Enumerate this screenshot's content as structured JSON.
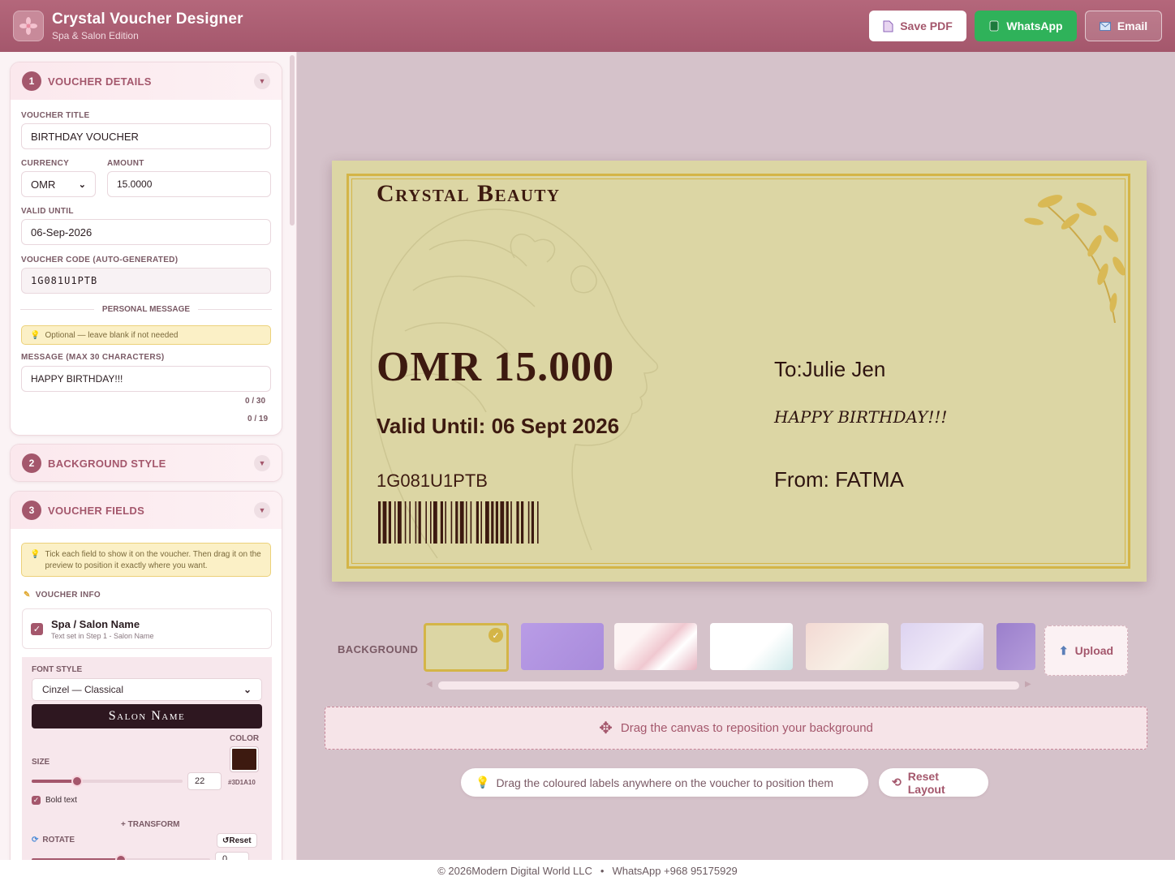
{
  "header": {
    "title": "Crystal Voucher Designer",
    "subtitle": "Spa & Salon Edition",
    "save_pdf": "Save PDF",
    "whatsapp": "WhatsApp",
    "email": "Email"
  },
  "sidebar": {
    "step1": {
      "num": "1",
      "title": "VOUCHER DETAILS"
    },
    "voucher_title_label": "VOUCHER TITLE",
    "voucher_title_value": "BIRTHDAY VOUCHER",
    "currency_label": "CURRENCY",
    "currency_value": "OMR",
    "amount_label": "AMOUNT",
    "amount_value": "15.0000",
    "valid_label": "VALID UNTIL",
    "valid_value": "06-Sep-2026",
    "code_label": "VOUCHER CODE (AUTO-GENERATED)",
    "code_value": "1G081U1PTB",
    "personal_message_sep": "PERSONAL MESSAGE",
    "optional_note": "Optional — leave blank if not needed",
    "message_label": "MESSAGE (MAX 30 CHARACTERS)",
    "message_value": "HAPPY BIRTHDAY!!!",
    "counter1": "0 / 30",
    "counter2": "0 / 19",
    "step2": {
      "num": "2",
      "title": "BACKGROUND STYLE"
    },
    "step3": {
      "num": "3",
      "title": "VOUCHER FIELDS"
    },
    "fields_note": "Tick each field to show it on the voucher. Then drag it on the preview to position it exactly where you want.",
    "voucher_info": "VOUCHER INFO",
    "field_item_title": "Spa / Salon Name",
    "field_item_sub": "Text set in Step 1 - Salon Name",
    "font_style_label": "FONT STYLE",
    "font_style_value": "Cinzel — Classical",
    "font_preview": "Salon Name",
    "color_label": "COLOR",
    "color_hex": "#3D1A10",
    "size_label": "SIZE",
    "size_value": "22",
    "size_fraction": 0.3,
    "bold_label": "Bold text",
    "transform_label": "+ TRANSFORM",
    "rotate_label": "ROTATE",
    "reset_label": "Reset",
    "rotate_value": "0",
    "rotate_fraction": 0.5
  },
  "voucher": {
    "salon": "Crystal Beauty",
    "amount": "OMR 15.000",
    "valid": "Valid Until: 06 Sept 2026",
    "code": "1G081U1PTB",
    "to": "To:Julie Jen",
    "message": "HAPPY BIRTHDAY!!!",
    "from": "From: FATMA",
    "bg_color": "#dcd6a4",
    "text_color": "#3d1a10",
    "gold": "#d4b547"
  },
  "backgrounds": {
    "label": "BACKGROUND",
    "upload": "Upload"
  },
  "drag_hint": "Drag the canvas to reposition your background",
  "labels_hint": "Drag the coloured labels anywhere on the voucher to position them",
  "reset_layout": "Reset Layout",
  "footer": {
    "copyright": "© 2026Modern Digital World LLC",
    "whatsapp": "WhatsApp +968 95175929"
  },
  "colors": {
    "accent": "#a4576c",
    "whatsapp": "#2fb25a"
  }
}
